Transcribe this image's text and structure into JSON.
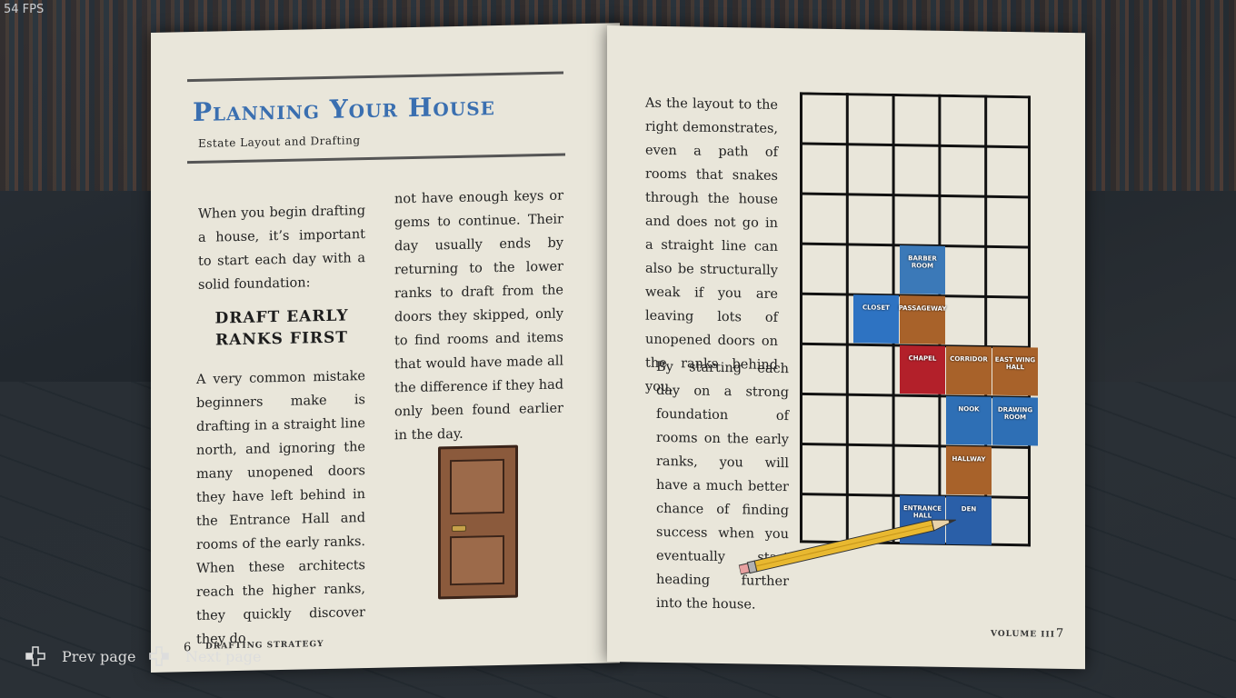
{
  "hud": {
    "fps": "54 FPS"
  },
  "left_page": {
    "title": "Planning Your House",
    "subtitle": "Estate Layout and Drafting",
    "intro": "When you begin drafting a house, it’s important to start each day with a solid foundation:",
    "heading": "DRAFT EARLY RANKS FIRST",
    "col1_body": "A very common mistake beginners make is drafting in a straight line north, and ignoring the many unopened doors they have left behind in the Entrance Hall and rooms of the early ranks. When these architects reach the higher ranks, they quickly discover they do",
    "col2_body": "not have enough keys or gems to continue. Their day usually ends by returning to the lower ranks to draft from the doors they skipped, only to find rooms and items that would have made all the difference if they had only been found earlier in the day.",
    "page_number": "6",
    "footer": "DRAFTING STRATEGY"
  },
  "right_page": {
    "para1": "As the layout to the right demonstrates, even a path of rooms that snakes through the house and does not go in a straight line can also be structurally weak if you are leaving lots of unopened doors on the ranks behind you.",
    "para2": "By starting each day on a strong foundation of rooms on the early ranks, you will have a much better chance of finding success when you eventually start heading further into the house.",
    "footer": "VOLUME III",
    "page_number": "7",
    "rooms": [
      {
        "label": "BARBER ROOM",
        "color": "#3b79b8"
      },
      {
        "label": "CLOSET",
        "color": "#2e73c2"
      },
      {
        "label": "PASSAGEWAY",
        "color": "#a8622a"
      },
      {
        "label": "CHAPEL",
        "color": "#b3202a"
      },
      {
        "label": "CORRIDOR",
        "color": "#a8622a"
      },
      {
        "label": "EAST WING HALL",
        "color": "#a8622a"
      },
      {
        "label": "NOOK",
        "color": "#2e6fb5"
      },
      {
        "label": "DRAWING ROOM",
        "color": "#2e6fb5"
      },
      {
        "label": "HALLWAY",
        "color": "#a8622a"
      },
      {
        "label": "ENTRANCE HALL",
        "color": "#2a5fa8"
      },
      {
        "label": "DEN",
        "color": "#2a5fa8"
      }
    ]
  },
  "controls": {
    "prev_label": "Prev page",
    "next_label": "Next page"
  }
}
